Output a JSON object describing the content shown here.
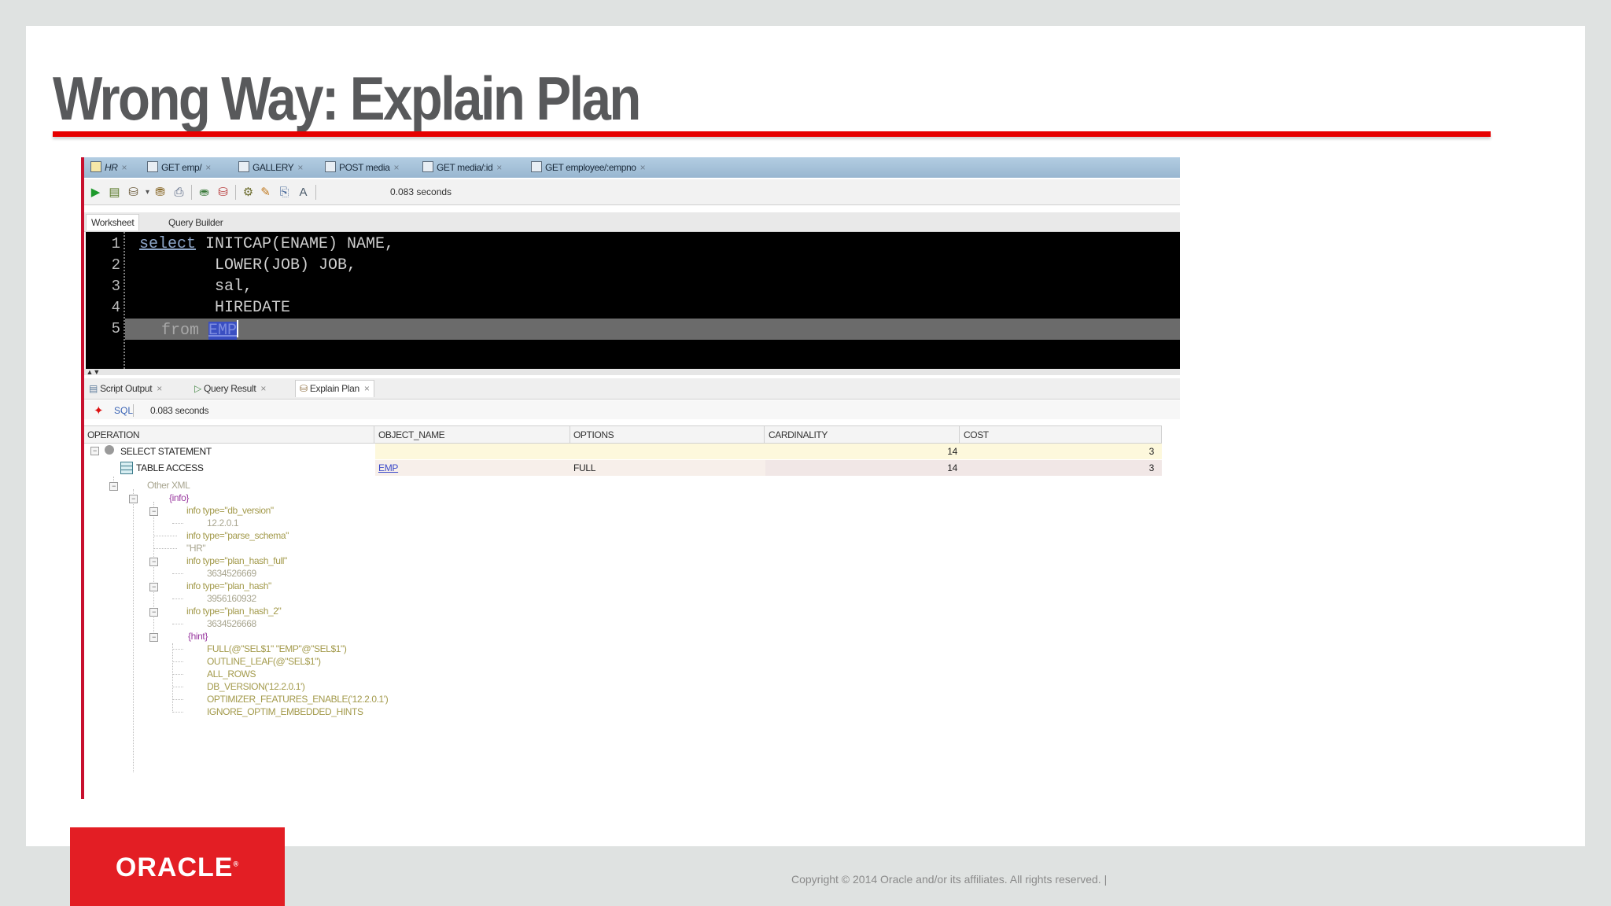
{
  "slide": {
    "title": "Wrong Way: Explain Plan",
    "copyright": "Copyright © 2014 Oracle and/or its affiliates. All rights reserved.  |",
    "logo": "ORACLE",
    "logo_mark": "®",
    "accent_color": "#e60000"
  },
  "ide": {
    "tabs": [
      {
        "label": "HR",
        "icon": "database-icon"
      },
      {
        "label": "GET emp/",
        "icon": "rest-doc-icon"
      },
      {
        "label": "GALLERY",
        "icon": "window-icon"
      },
      {
        "label": "POST media",
        "icon": "rest-doc-icon"
      },
      {
        "label": "GET media/:id",
        "icon": "rest-doc-icon"
      },
      {
        "label": "GET employee/:empno",
        "icon": "rest-doc-icon"
      }
    ],
    "toolbar_time": "0.083 seconds",
    "subtabs": {
      "worksheet": "Worksheet",
      "query_builder": "Query Builder"
    },
    "editor": {
      "line_numbers": [
        "1",
        "2",
        "3",
        "4",
        "5"
      ],
      "line1_kw": "select",
      "line1_rest": " INITCAP(ENAME) NAME,",
      "line2": "LOWER(JOB) JOB,",
      "line3": "sal,",
      "line4": "HIREDATE",
      "line5_kw": "from",
      "line5_table": "EMP"
    },
    "output_tabs": {
      "script_output": "Script Output",
      "query_result": "Query Result",
      "explain_plan": "Explain Plan"
    },
    "plan_toolbar": {
      "sql": "SQL",
      "time": "0.083 seconds"
    },
    "grid": {
      "columns": [
        "OPERATION",
        "OBJECT_NAME",
        "OPTIONS",
        "CARDINALITY",
        "COST"
      ],
      "rows": [
        {
          "operation": "SELECT STATEMENT",
          "object_name": "",
          "options": "",
          "cardinality": "14",
          "cost": "3"
        },
        {
          "operation": "TABLE ACCESS",
          "object_name": "EMP",
          "options": "FULL",
          "cardinality": "14",
          "cost": "3"
        }
      ]
    },
    "tree": {
      "other_xml": "Other XML",
      "info": "{info}",
      "info_db_version": "info type=\"db_version\"",
      "db_version_val": "12.2.0.1",
      "info_parse_schema": "info type=\"parse_schema\"",
      "parse_schema_val": "\"HR\"",
      "info_plan_hash_full": "info type=\"plan_hash_full\"",
      "plan_hash_full_val": "3634526669",
      "info_plan_hash": "info type=\"plan_hash\"",
      "plan_hash_val": "3956160932",
      "info_plan_hash_2": "info type=\"plan_hash_2\"",
      "plan_hash_2_val": "3634526668",
      "hint": "{hint}",
      "hints": [
        "FULL(@\"SEL$1\" \"EMP\"@\"SEL$1\")",
        "OUTLINE_LEAF(@\"SEL$1\")",
        "ALL_ROWS",
        "DB_VERSION('12.2.0.1')",
        "OPTIMIZER_FEATURES_ENABLE('12.2.0.1')",
        "IGNORE_OPTIM_EMBEDDED_HINTS"
      ]
    }
  }
}
